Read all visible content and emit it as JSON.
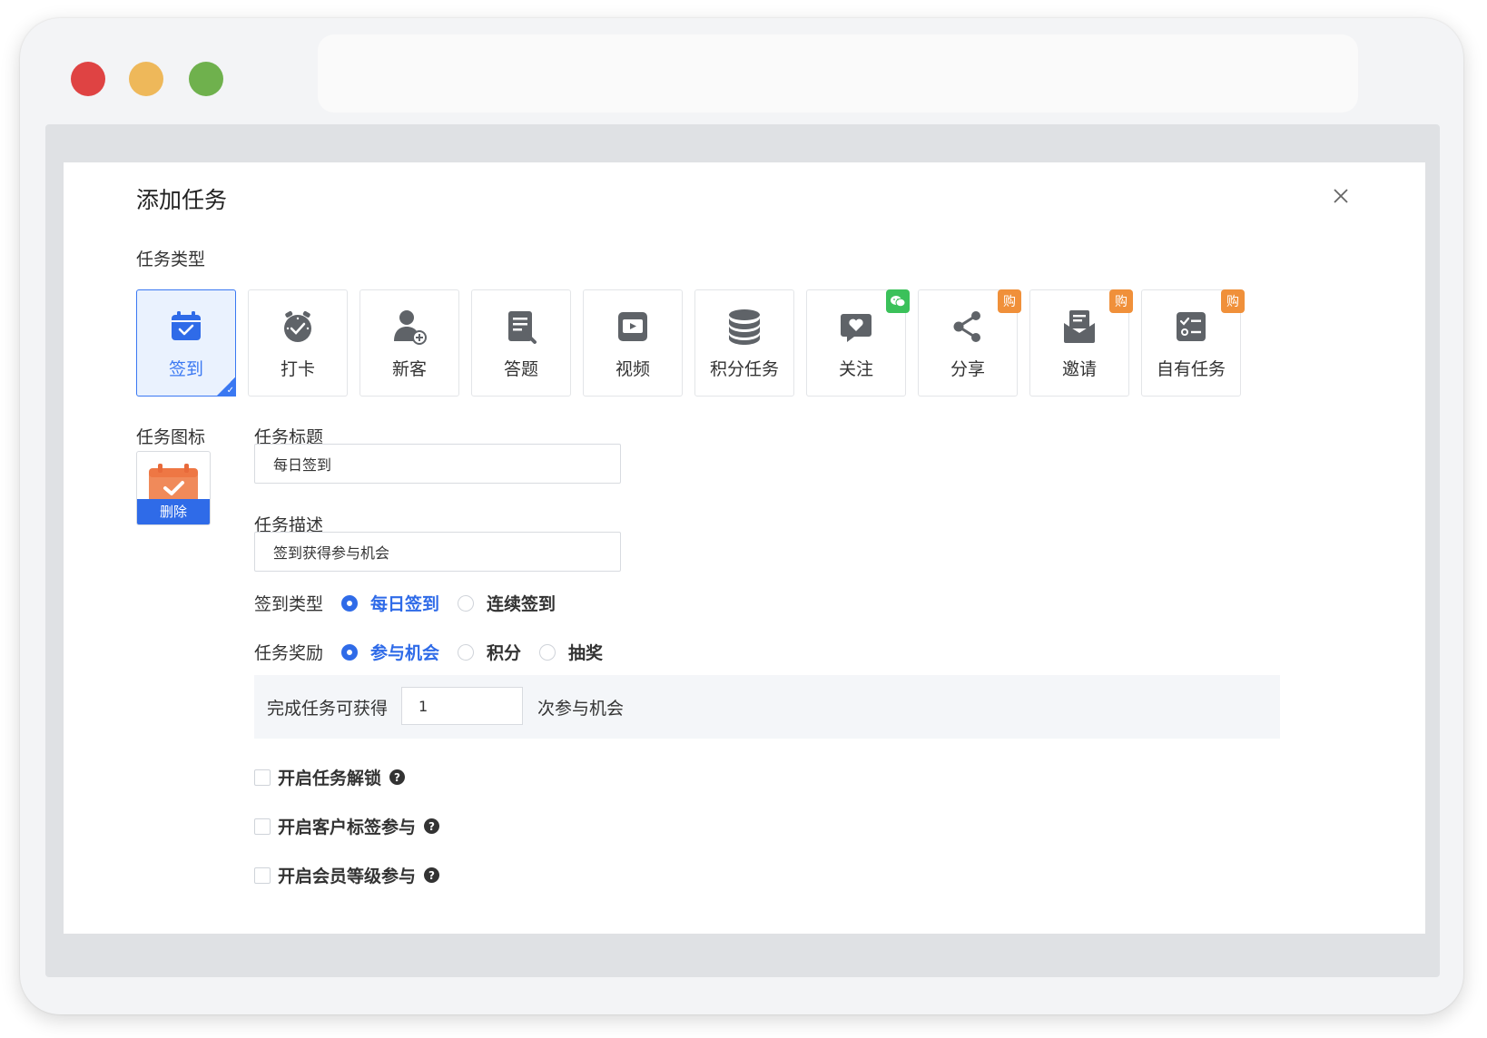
{
  "dialog": {
    "title": "添加任务"
  },
  "task_type": {
    "label": "任务类型",
    "items": [
      {
        "label": "签到",
        "icon": "calendar-check-icon",
        "selected": true
      },
      {
        "label": "打卡",
        "icon": "alarm-clock-icon"
      },
      {
        "label": "新客",
        "icon": "user-add-icon"
      },
      {
        "label": "答题",
        "icon": "document-edit-icon"
      },
      {
        "label": "视频",
        "icon": "video-play-icon"
      },
      {
        "label": "积分任务",
        "icon": "coins-stack-icon"
      },
      {
        "label": "关注",
        "icon": "heart-message-icon",
        "badge": "wechat-icon"
      },
      {
        "label": "分享",
        "icon": "share-icon",
        "badge": "购"
      },
      {
        "label": "邀请",
        "icon": "invitation-icon",
        "badge": "购"
      },
      {
        "label": "自有任务",
        "icon": "checklist-icon",
        "badge": "购"
      }
    ]
  },
  "task_icon": {
    "label": "任务图标",
    "delete_label": "删除"
  },
  "task_title": {
    "label": "任务标题",
    "value": "每日签到"
  },
  "task_desc": {
    "label": "任务描述",
    "value": "签到获得参与机会"
  },
  "signin_type": {
    "label": "签到类型",
    "options": [
      "每日签到",
      "连续签到"
    ],
    "selected": "每日签到"
  },
  "reward": {
    "label": "任务奖励",
    "options": [
      "参与机会",
      "积分",
      "抽奖"
    ],
    "selected": "参与机会",
    "prefix": "完成任务可获得",
    "count": "1",
    "suffix": "次参与机会"
  },
  "options": [
    {
      "label": "开启任务解锁"
    },
    {
      "label": "开启客户标签参与"
    },
    {
      "label": "开启会员等级参与"
    }
  ],
  "help_glyph": "?",
  "colors": {
    "accent": "#2f6be8",
    "badge_orange": "#f0903a",
    "badge_green": "#3bc15a"
  }
}
